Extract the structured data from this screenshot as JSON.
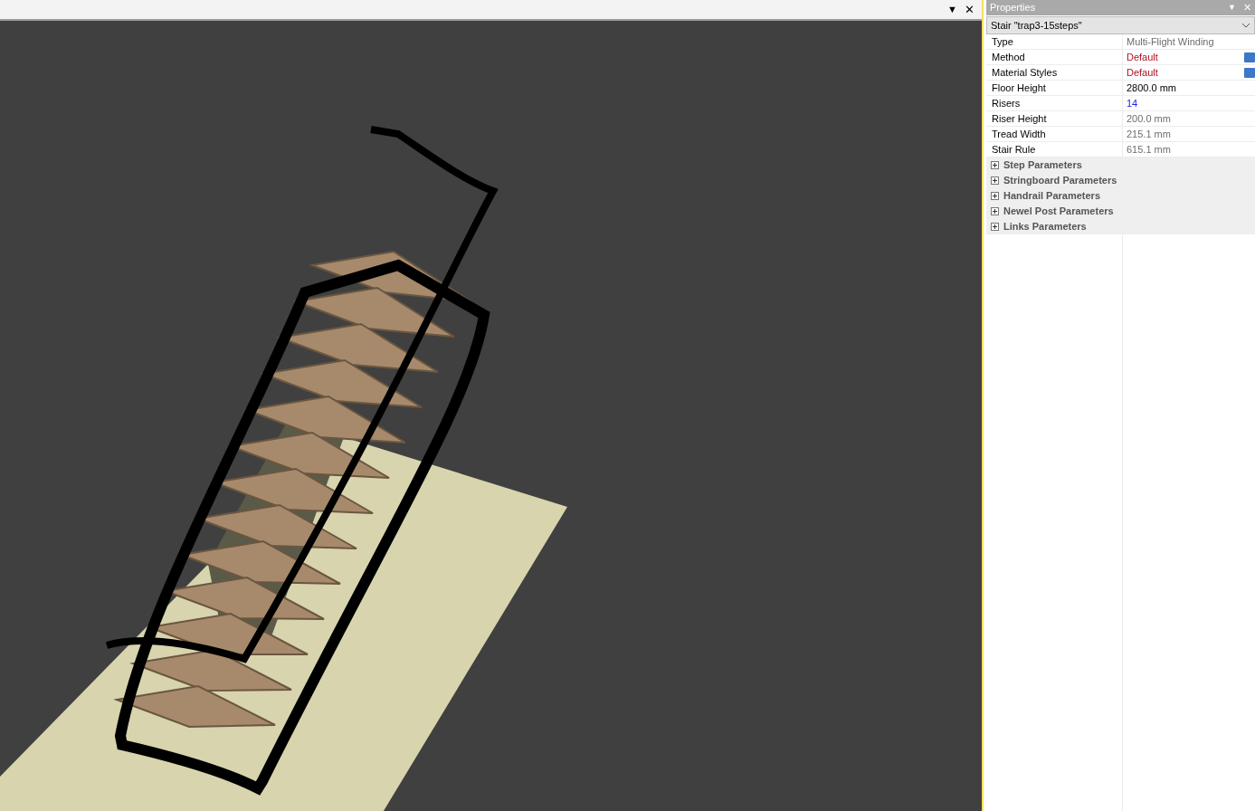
{
  "viewport": {
    "menu_glyph": "▼",
    "close_glyph": "✕"
  },
  "properties": {
    "title": "Properties",
    "object": "Stair \"trap3-15steps\"",
    "rows": [
      {
        "label": "Type",
        "value": "Multi-Flight Winding",
        "kind": "readonly"
      },
      {
        "label": "Method",
        "value": "Default",
        "kind": "inherited"
      },
      {
        "label": "Material Styles",
        "value": "Default",
        "kind": "inherited"
      },
      {
        "label": "Floor Height",
        "value": "2800.0 mm",
        "kind": "normal"
      },
      {
        "label": "Risers",
        "value": "14",
        "kind": "number"
      },
      {
        "label": "Riser Height",
        "value": "200.0 mm",
        "kind": "readonly"
      },
      {
        "label": "Tread Width",
        "value": "215.1 mm",
        "kind": "readonly"
      },
      {
        "label": "Stair Rule",
        "value": "615.1 mm",
        "kind": "readonly"
      }
    ],
    "groups": [
      {
        "label": "Step Parameters",
        "expanded": false
      },
      {
        "label": "Stringboard Parameters",
        "expanded": false
      },
      {
        "label": "Handrail Parameters",
        "expanded": false
      },
      {
        "label": "Newel Post Parameters",
        "expanded": false
      },
      {
        "label": "Links Parameters",
        "expanded": false
      }
    ]
  }
}
